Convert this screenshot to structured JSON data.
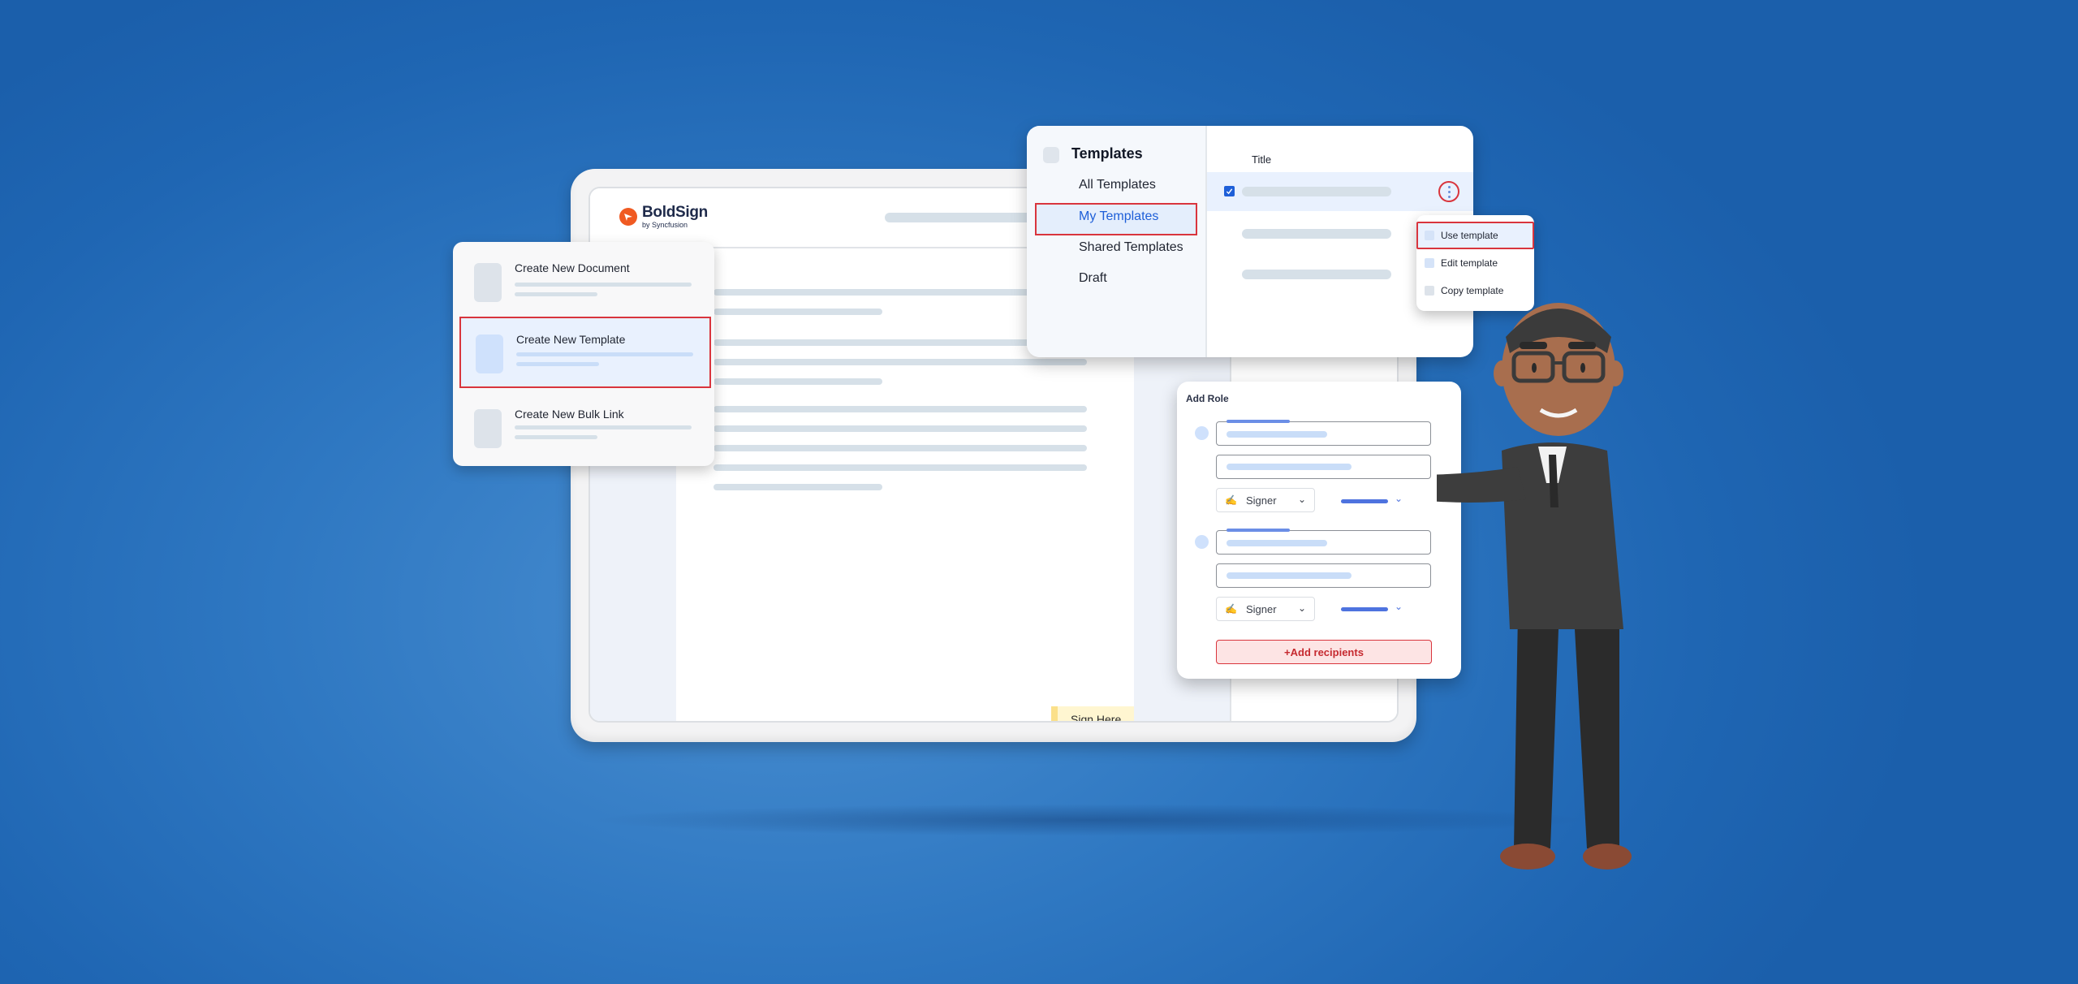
{
  "brand": {
    "name": "BoldSign",
    "subtitle": "by Syncfusion",
    "logo_icon": "paper-plane-icon",
    "accent_color": "#f05a22"
  },
  "create_menu": {
    "items": [
      {
        "label": "Create New Document",
        "selected": false
      },
      {
        "label": "Create New Template",
        "selected": true
      },
      {
        "label": "Create New Bulk Link",
        "selected": false
      }
    ]
  },
  "templates_panel": {
    "heading": "Templates",
    "nav": [
      {
        "label": "All Templates",
        "selected": false
      },
      {
        "label": "My Templates",
        "selected": true
      },
      {
        "label": "Shared Templates",
        "selected": false
      },
      {
        "label": "Draft",
        "selected": false
      }
    ],
    "table": {
      "column_title": "Title",
      "rows": [
        {
          "checked": true,
          "selected": true
        },
        {
          "checked": false,
          "selected": false
        },
        {
          "checked": false,
          "selected": false
        }
      ],
      "row_menu_icon": "kebab-menu-icon"
    }
  },
  "context_menu": {
    "items": [
      {
        "label": "Use template",
        "selected": true
      },
      {
        "label": "Edit template",
        "selected": false
      },
      {
        "label": "Copy template",
        "selected": false
      }
    ]
  },
  "document": {
    "sign_here_label": "Sign Here"
  },
  "add_role": {
    "title": "Add Role",
    "roles": [
      {
        "role_select": "Signer"
      },
      {
        "role_select": "Signer"
      }
    ],
    "add_recipients_label": "+Add recipients"
  },
  "colors": {
    "highlight_border": "#d9353d",
    "selection_bg": "#e9f1fe",
    "primary_blue": "#1e5fd8",
    "background_blue": "#2f78c2"
  }
}
